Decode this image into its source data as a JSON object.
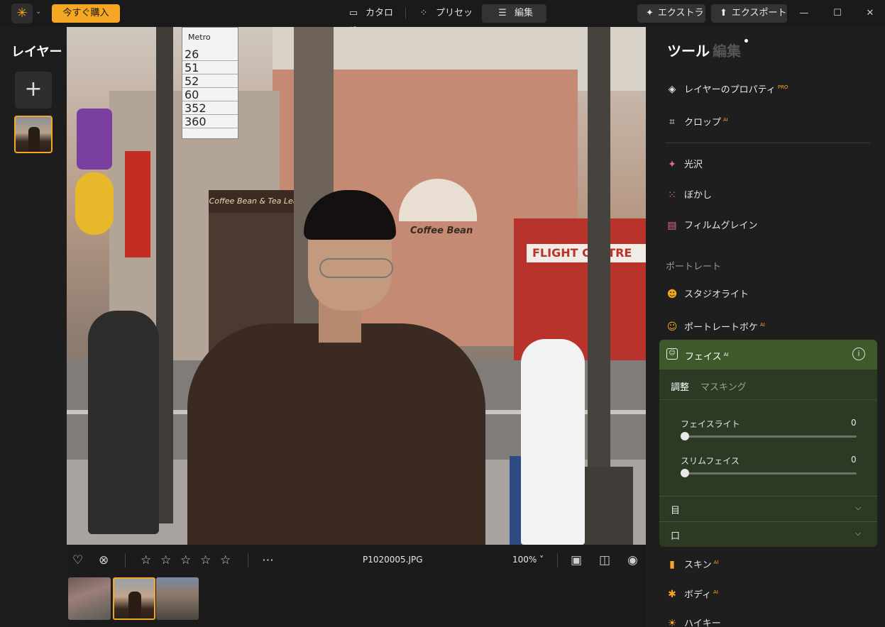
{
  "titlebar": {
    "buy_label": "今すぐ購入",
    "tabs": [
      {
        "label": "カタログ",
        "icon": "folder-icon"
      },
      {
        "label": "プリセット",
        "icon": "sparkle-dots-icon"
      },
      {
        "label": "編集",
        "icon": "sliders-icon"
      }
    ],
    "extras_label": "エクストラ",
    "export_label": "エクスポート",
    "accent": "#f5a623"
  },
  "left_panel": {
    "title": "レイヤー"
  },
  "photo": {
    "metro_sign": {
      "header": "Metro",
      "routes": [
        "26",
        "51",
        "52",
        "60",
        "352",
        "360"
      ]
    },
    "store_signs": [
      "Coffee Bean & Tea Leaf",
      "Coffee Bean",
      "FLIGHT CENTRE"
    ]
  },
  "bottom_bar": {
    "rating_stars": 5,
    "filename": "P1020005.JPG",
    "zoom": "100%"
  },
  "right_panel": {
    "title_tools": "ツール",
    "title_edit": "編集",
    "items_top": [
      {
        "label": "レイヤーのプロパティ",
        "badge": "PRO",
        "icon": "layers-icon"
      },
      {
        "label": "クロップ",
        "badge": "AI",
        "icon": "crop-icon"
      }
    ],
    "items_mid": [
      {
        "label": "光沢",
        "icon": "sparkle-icon"
      },
      {
        "label": "ぼかし",
        "icon": "blur-grid-icon"
      },
      {
        "label": "フィルムグレイン",
        "icon": "film-icon"
      }
    ],
    "portrait_section": "ポートレート",
    "items_portrait": [
      {
        "label": "スタジオライト",
        "icon": "studio-light-icon"
      },
      {
        "label": "ポートレートボケ",
        "badge": "AI",
        "icon": "portrait-bokeh-icon"
      }
    ],
    "face_panel": {
      "title": "フェイス",
      "badge": "AI",
      "tabs": [
        "調整",
        "マスキング"
      ],
      "sliders": [
        {
          "label": "フェイスライト",
          "value": "0"
        },
        {
          "label": "スリムフェイス",
          "value": "0"
        }
      ],
      "accordions": [
        "目",
        "口"
      ]
    },
    "items_bottom": [
      {
        "label": "スキン",
        "badge": "AI",
        "icon": "skin-icon"
      },
      {
        "label": "ボディ",
        "badge": "AI",
        "icon": "body-icon"
      },
      {
        "label": "ハイキー",
        "icon": "high-key-icon"
      }
    ]
  }
}
